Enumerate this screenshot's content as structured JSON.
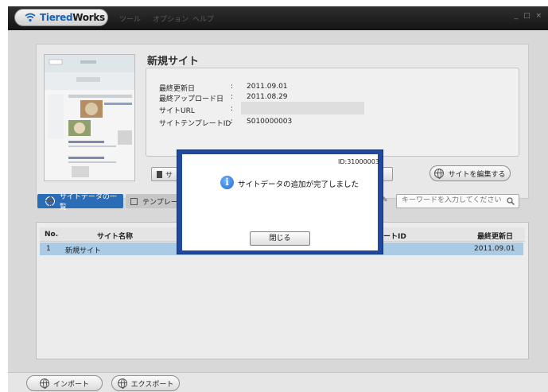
{
  "app": {
    "name_part1": "Tiered",
    "name_part2": "Works",
    "menu": [
      "ツール",
      "オプション",
      "ヘルプ"
    ],
    "window_controls": "_ □ ×"
  },
  "site": {
    "title": "新規サイト",
    "fields": [
      {
        "label": "最終更新日",
        "value": "2011.09.01"
      },
      {
        "label": "最終アップロード日",
        "value": "2011.08.29"
      },
      {
        "label": "サイトURL",
        "value": ""
      },
      {
        "label": "サイトテンプレートID",
        "value": "S010000003"
      }
    ],
    "edit_button": "サイトを編集する",
    "action_button_partial": "サ"
  },
  "tabs": {
    "sitedata": "サイトデータの一覧",
    "template": "テンプレート"
  },
  "search": {
    "placeholder": "キーワードを入力してください"
  },
  "table": {
    "headers": {
      "no": "No.",
      "name": "サイト名称",
      "template_id": "ートID",
      "updated": "最終更新日"
    },
    "rows": [
      {
        "no": "1",
        "name": "新規サイト",
        "updated": "2011.09.01"
      }
    ]
  },
  "footer": {
    "import": "インポート",
    "export": "エクスポート"
  },
  "dialog": {
    "id": "ID:31000003",
    "message": "サイトデータの追加が完了しました",
    "close": "閉じる"
  },
  "colors": {
    "accent": "#2a6cb5",
    "dialog_frame": "#1f4aa0",
    "selected_row": "#a9cbe6"
  }
}
